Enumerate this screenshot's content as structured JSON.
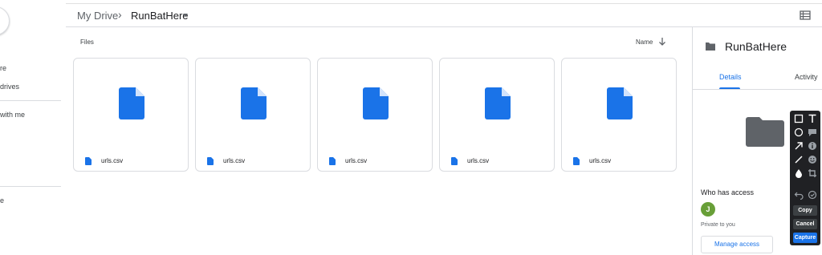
{
  "sidebar": {
    "items": [
      {
        "label": "re"
      },
      {
        "label": "drives"
      },
      {
        "label": "with me"
      },
      {
        "label": "e"
      }
    ]
  },
  "header": {
    "breadcrumb_root": "My Drive",
    "breadcrumb_separator": "›",
    "breadcrumb_current": "RunBatHere"
  },
  "files": {
    "section_label": "Files",
    "sort_label": "Name",
    "items": [
      {
        "name": "urls.csv"
      },
      {
        "name": "urls.csv"
      },
      {
        "name": "urls.csv"
      },
      {
        "name": "urls.csv"
      },
      {
        "name": "urls.csv"
      }
    ]
  },
  "details": {
    "title": "RunBatHere",
    "tabs": [
      {
        "label": "Details",
        "active": true
      },
      {
        "label": "Activity",
        "active": false
      }
    ],
    "who_has_access_label": "Who has access",
    "avatar_initial": "J",
    "private_text": "Private to you",
    "manage_access_label": "Manage access"
  },
  "capture_toolbar": {
    "tools": [
      "rectangle-icon",
      "text-icon",
      "ellipse-icon",
      "speech-bubble-icon",
      "arrow-icon",
      "info-icon",
      "line-icon",
      "emoji-icon",
      "drop-icon",
      "crop-icon",
      "undo-icon",
      "redo-icon"
    ],
    "copy_label": "Copy",
    "cancel_label": "Cancel",
    "capture_label": "Capture"
  },
  "colors": {
    "accent": "#1a73e8",
    "file_icon": "#1a73e8",
    "folder_icon": "#5f6368",
    "avatar": "#689f38",
    "toolbar_bg": "#202124"
  }
}
